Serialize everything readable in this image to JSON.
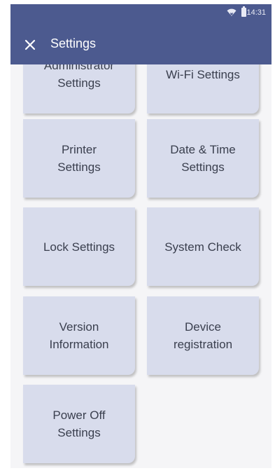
{
  "status_bar": {
    "time": "14:31",
    "icons": [
      "wifi-icon",
      "battery-icon"
    ]
  },
  "app_bar": {
    "close_icon": "close-icon",
    "title": "Settings",
    "background": "#4c5a8f"
  },
  "tiles": [
    {
      "label": "Administrator\nSettings"
    },
    {
      "label": "Wi-Fi Settings"
    },
    {
      "label": "Printer\nSettings"
    },
    {
      "label": "Date & Time\nSettings"
    },
    {
      "label": "Lock Settings"
    },
    {
      "label": "System Check"
    },
    {
      "label": "Version\nInformation"
    },
    {
      "label": "Device\nregistration"
    },
    {
      "label": "Power Off\nSettings"
    }
  ],
  "colors": {
    "tile_background": "#d8dcec",
    "tile_text": "#3a3f4e",
    "page_background": "#f5f5f7"
  }
}
